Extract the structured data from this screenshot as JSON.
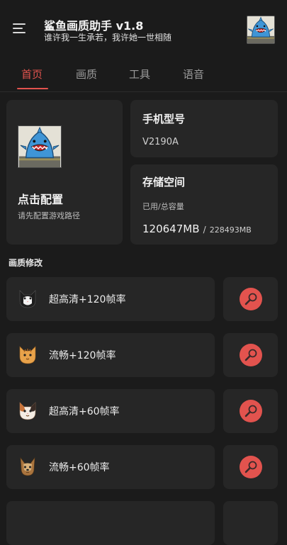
{
  "header": {
    "title": "鲨鱼画质助手 v1.8",
    "subtitle": "谁许我一生承若，我许她一世相随",
    "menu_icon": "menu-icon",
    "avatar_icon": "shark-avatar"
  },
  "tabs": [
    {
      "label": "首页",
      "active": true
    },
    {
      "label": "画质",
      "active": false
    },
    {
      "label": "工具",
      "active": false
    },
    {
      "label": "语音",
      "active": false
    }
  ],
  "config": {
    "title": "点击配置",
    "subtitle": "请先配置游戏路径"
  },
  "device": {
    "title": "手机型号",
    "model": "V2190A"
  },
  "storage": {
    "title": "存储空间",
    "label": "已用/总容量",
    "used": "120647MB",
    "separator": "/",
    "total": "228493MB"
  },
  "quality_section": {
    "title": "画质修改",
    "items": [
      {
        "label": "超高清+120帧率",
        "icon": "black-cat-icon"
      },
      {
        "label": "流畅+120帧率",
        "icon": "orange-cat-icon"
      },
      {
        "label": "超高清+60帧率",
        "icon": "calico-cat-icon"
      },
      {
        "label": "流畅+60帧率",
        "icon": "yorkie-dog-icon"
      }
    ]
  },
  "colors": {
    "background": "#1b1b1b",
    "card": "#262626",
    "accent": "#e2534e",
    "search_button": "#e2534e"
  }
}
